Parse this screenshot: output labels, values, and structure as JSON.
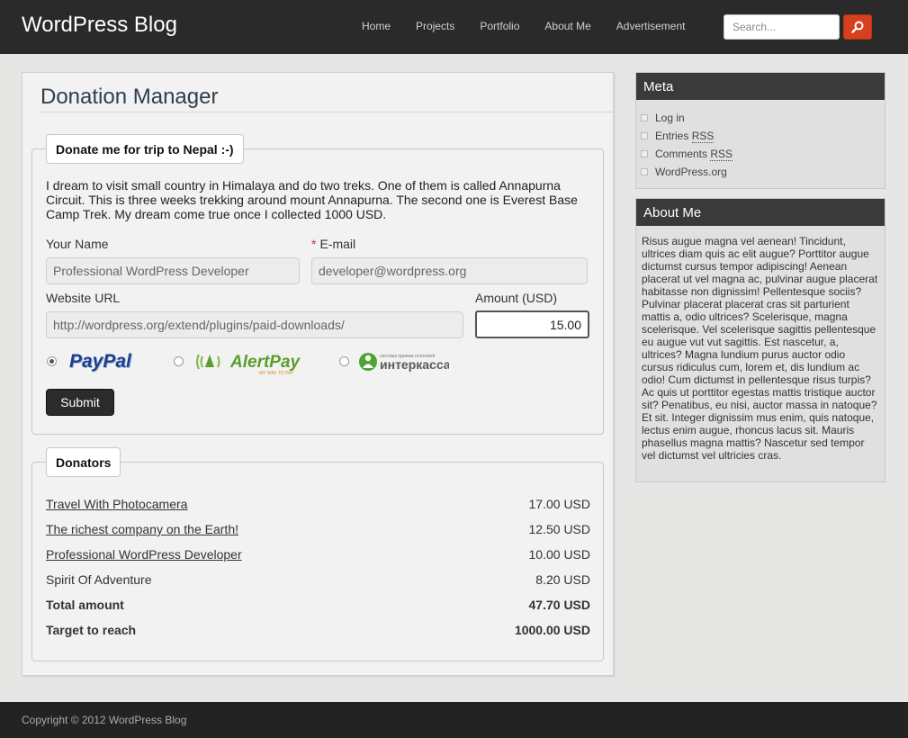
{
  "header": {
    "site_title": "WordPress Blog",
    "nav": [
      "Home",
      "Projects",
      "Portfolio",
      "About Me",
      "Advertisement"
    ],
    "search_placeholder": "Search..."
  },
  "main": {
    "title": "Donation Manager",
    "form": {
      "legend": "Donate me for trip to Nepal :-)",
      "intro": "I dream to visit small country in Himalaya and do two treks. One of them is called Annapurna Circuit. This is three weeks trekking around mount Annapurna. The second one is Everest Base Camp Trek. My dream come true once I collected 1000 USD.",
      "name_label": "Your Name",
      "name_value": "Professional WordPress Developer",
      "email_required": "*",
      "email_label": "E-mail",
      "email_value": "developer@wordpress.org",
      "url_label": "Website URL",
      "url_value": "http://wordpress.org/extend/plugins/paid-downloads/",
      "amount_label": "Amount (USD)",
      "amount_value": "15.00",
      "payment_methods": [
        "PayPal",
        "AlertPay",
        "интеркасса"
      ],
      "alertpay_tagline": "MY WAY TO PAY",
      "interkassa_tagline": "система приема платежей",
      "selected_payment": "PayPal",
      "submit_label": "Submit"
    },
    "donators": {
      "legend": "Donators",
      "rows": [
        {
          "name": "Travel With Photocamera",
          "amount": "17.00 USD"
        },
        {
          "name": "The richest company on the Earth!",
          "amount": "12.50 USD"
        },
        {
          "name": "Professional WordPress Developer",
          "amount": "10.00 USD"
        },
        {
          "name": "Spirit Of Adventure",
          "amount": "8.20 USD"
        }
      ],
      "total_label": "Total amount",
      "total_value": "47.70 USD",
      "target_label": "Target to reach",
      "target_value": "1000.00 USD"
    }
  },
  "sidebar": {
    "meta_title": "Meta",
    "meta_items": {
      "login": "Log in",
      "entries": "Entries",
      "entries_abbr": "RSS",
      "comments": "Comments",
      "comments_abbr": "RSS",
      "wordpress": "WordPress.org"
    },
    "about_title": "About Me",
    "about_text": "Risus augue magna vel aenean! Tincidunt, ultrices diam quis ac elit augue? Porttitor augue dictumst cursus tempor adipiscing! Aenean placerat ut vel magna ac, pulvinar augue placerat habitasse non dignissim! Pellentesque sociis? Pulvinar placerat placerat cras sit parturient mattis a, odio ultrices? Scelerisque, magna scelerisque. Vel scelerisque sagittis pellentesque eu augue vut vut sagittis. Est nascetur, a, ultrices? Magna lundium purus auctor odio cursus ridiculus cum, lorem et, dis lundium ac odio! Cum dictumst in pellentesque risus turpis? Ac quis ut porttitor egestas mattis tristique auctor sit? Penatibus, eu nisi, auctor massa in natoque? Et sit. Integer dignissim mus enim, quis natoque, lectus enim augue, rhoncus lacus sit. Mauris phasellus magna mattis? Nascetur sed tempor vel dictumst vel ultricies cras."
  },
  "footer": {
    "copyright": "Copyright © 2012 WordPress Blog"
  },
  "colors": {
    "header_bg": "#2a2a2a",
    "search_button": "#d6401f",
    "title_color": "#2f3d4e",
    "paypal_blue": "#1e3f8f",
    "alertpay_green": "#5b9d2a"
  }
}
